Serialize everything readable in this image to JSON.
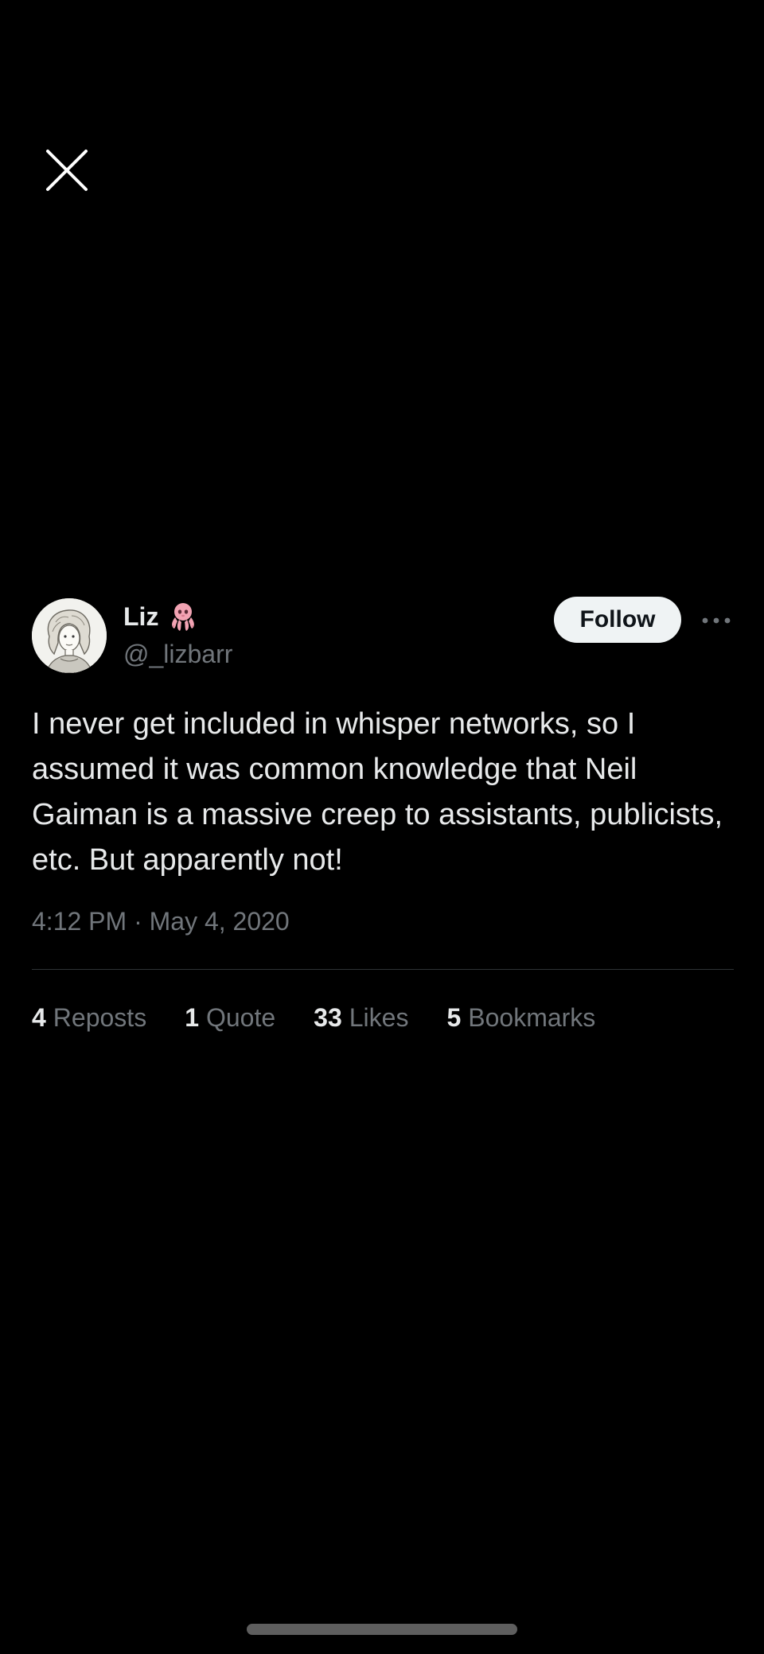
{
  "tweet": {
    "display_name": "Liz",
    "handle": "@_lizbarr",
    "follow_label": "Follow",
    "text": "I never get included in whisper networks, so I assumed it was common knowledge that Neil Gaiman is a massive creep to assistants, publicists, etc. But apparently not!",
    "timestamp": "4:12 PM · May 4, 2020",
    "stats": [
      {
        "count": "4",
        "label": "Reposts"
      },
      {
        "count": "1",
        "label": "Quote"
      },
      {
        "count": "33",
        "label": "Likes"
      },
      {
        "count": "5",
        "label": "Bookmarks"
      }
    ]
  },
  "icons": {
    "close": "close-icon",
    "more": "more-options-icon",
    "name_emoji": "octopus-emoji-icon"
  },
  "colors": {
    "background": "#000000",
    "primary_text": "#e7e9ea",
    "secondary_text": "#71767b",
    "follow_button_bg": "#eff3f4",
    "divider": "#2f3336"
  }
}
